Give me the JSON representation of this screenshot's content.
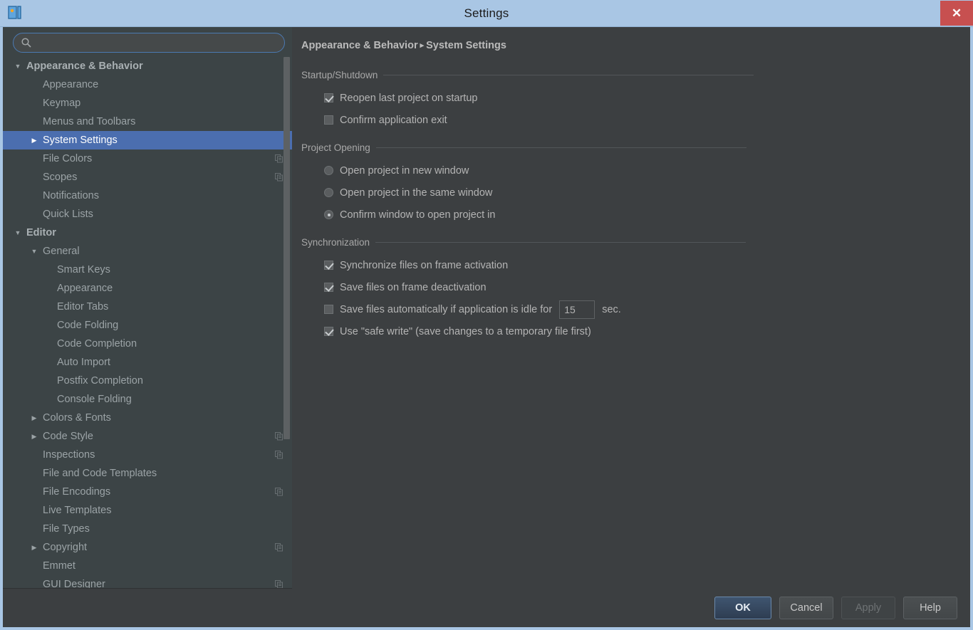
{
  "window": {
    "title": "Settings",
    "app_icon": "intellij-idea-icon",
    "close_label": "✕"
  },
  "search": {
    "value": "",
    "placeholder": "",
    "icon": "search-icon"
  },
  "tree": {
    "scrollbar": {
      "thumb_top_pct": 0,
      "thumb_height_pct": 72
    },
    "nodes": [
      {
        "label": "Appearance & Behavior",
        "level": 0,
        "arrow": "▼",
        "group": true,
        "selected": false,
        "project_icon": false
      },
      {
        "label": "Appearance",
        "level": 1,
        "arrow": "",
        "group": false,
        "selected": false,
        "project_icon": false
      },
      {
        "label": "Keymap",
        "level": 1,
        "arrow": "",
        "group": false,
        "selected": false,
        "project_icon": false
      },
      {
        "label": "Menus and Toolbars",
        "level": 1,
        "arrow": "",
        "group": false,
        "selected": false,
        "project_icon": false
      },
      {
        "label": "System Settings",
        "level": 1,
        "arrow": "▶",
        "group": false,
        "selected": true,
        "project_icon": false
      },
      {
        "label": "File Colors",
        "level": 1,
        "arrow": "",
        "group": false,
        "selected": false,
        "project_icon": true
      },
      {
        "label": "Scopes",
        "level": 1,
        "arrow": "",
        "group": false,
        "selected": false,
        "project_icon": true
      },
      {
        "label": "Notifications",
        "level": 1,
        "arrow": "",
        "group": false,
        "selected": false,
        "project_icon": false
      },
      {
        "label": "Quick Lists",
        "level": 1,
        "arrow": "",
        "group": false,
        "selected": false,
        "project_icon": false
      },
      {
        "label": "Editor",
        "level": 0,
        "arrow": "▼",
        "group": true,
        "selected": false,
        "project_icon": false
      },
      {
        "label": "General",
        "level": 1,
        "arrow": "▼",
        "group": false,
        "selected": false,
        "project_icon": false
      },
      {
        "label": "Smart Keys",
        "level": 2,
        "arrow": "",
        "group": false,
        "selected": false,
        "project_icon": false
      },
      {
        "label": "Appearance",
        "level": 2,
        "arrow": "",
        "group": false,
        "selected": false,
        "project_icon": false
      },
      {
        "label": "Editor Tabs",
        "level": 2,
        "arrow": "",
        "group": false,
        "selected": false,
        "project_icon": false
      },
      {
        "label": "Code Folding",
        "level": 2,
        "arrow": "",
        "group": false,
        "selected": false,
        "project_icon": false
      },
      {
        "label": "Code Completion",
        "level": 2,
        "arrow": "",
        "group": false,
        "selected": false,
        "project_icon": false
      },
      {
        "label": "Auto Import",
        "level": 2,
        "arrow": "",
        "group": false,
        "selected": false,
        "project_icon": false
      },
      {
        "label": "Postfix Completion",
        "level": 2,
        "arrow": "",
        "group": false,
        "selected": false,
        "project_icon": false
      },
      {
        "label": "Console Folding",
        "level": 2,
        "arrow": "",
        "group": false,
        "selected": false,
        "project_icon": false
      },
      {
        "label": "Colors & Fonts",
        "level": 1,
        "arrow": "▶",
        "group": false,
        "selected": false,
        "project_icon": false
      },
      {
        "label": "Code Style",
        "level": 1,
        "arrow": "▶",
        "group": false,
        "selected": false,
        "project_icon": true
      },
      {
        "label": "Inspections",
        "level": 1,
        "arrow": "",
        "group": false,
        "selected": false,
        "project_icon": true
      },
      {
        "label": "File and Code Templates",
        "level": 1,
        "arrow": "",
        "group": false,
        "selected": false,
        "project_icon": false
      },
      {
        "label": "File Encodings",
        "level": 1,
        "arrow": "",
        "group": false,
        "selected": false,
        "project_icon": true
      },
      {
        "label": "Live Templates",
        "level": 1,
        "arrow": "",
        "group": false,
        "selected": false,
        "project_icon": false
      },
      {
        "label": "File Types",
        "level": 1,
        "arrow": "",
        "group": false,
        "selected": false,
        "project_icon": false
      },
      {
        "label": "Copyright",
        "level": 1,
        "arrow": "▶",
        "group": false,
        "selected": false,
        "project_icon": true
      },
      {
        "label": "Emmet",
        "level": 1,
        "arrow": "",
        "group": false,
        "selected": false,
        "project_icon": false
      },
      {
        "label": "GUI Designer",
        "level": 1,
        "arrow": "",
        "group": false,
        "selected": false,
        "project_icon": true
      }
    ]
  },
  "breadcrumb": {
    "root": "Appearance & Behavior",
    "separator": "▸",
    "current": "System Settings"
  },
  "sections": [
    {
      "title": "Startup/Shutdown",
      "options": [
        {
          "type": "checkbox",
          "label": "Reopen last project on startup",
          "checked": true
        },
        {
          "type": "checkbox",
          "label": "Confirm application exit",
          "checked": false
        }
      ]
    },
    {
      "title": "Project Opening",
      "options": [
        {
          "type": "radio",
          "label": "Open project in new window",
          "checked": false
        },
        {
          "type": "radio",
          "label": "Open project in the same window",
          "checked": false
        },
        {
          "type": "radio",
          "label": "Confirm window to open project in",
          "checked": true
        }
      ]
    },
    {
      "title": "Synchronization",
      "options": [
        {
          "type": "checkbox",
          "label": "Synchronize files on frame activation",
          "checked": true
        },
        {
          "type": "checkbox",
          "label": "Save files on frame deactivation",
          "checked": true
        },
        {
          "type": "checkbox-field",
          "label": "Save files automatically if application is idle for",
          "checked": false,
          "field_value": "15",
          "suffix": "sec."
        },
        {
          "type": "checkbox",
          "label": "Use \"safe write\" (save changes to a temporary file first)",
          "checked": true
        }
      ]
    }
  ],
  "footer": {
    "ok": "OK",
    "cancel": "Cancel",
    "apply": "Apply",
    "help": "Help"
  },
  "colors": {
    "titlebar": "#a9c6e4",
    "close": "#c75050",
    "selection": "#4b6eaf",
    "panel": "#3c3f41",
    "tree_panel": "#3c4446",
    "text": "#b4b4b4",
    "accent_border": "#4b7ab3"
  }
}
